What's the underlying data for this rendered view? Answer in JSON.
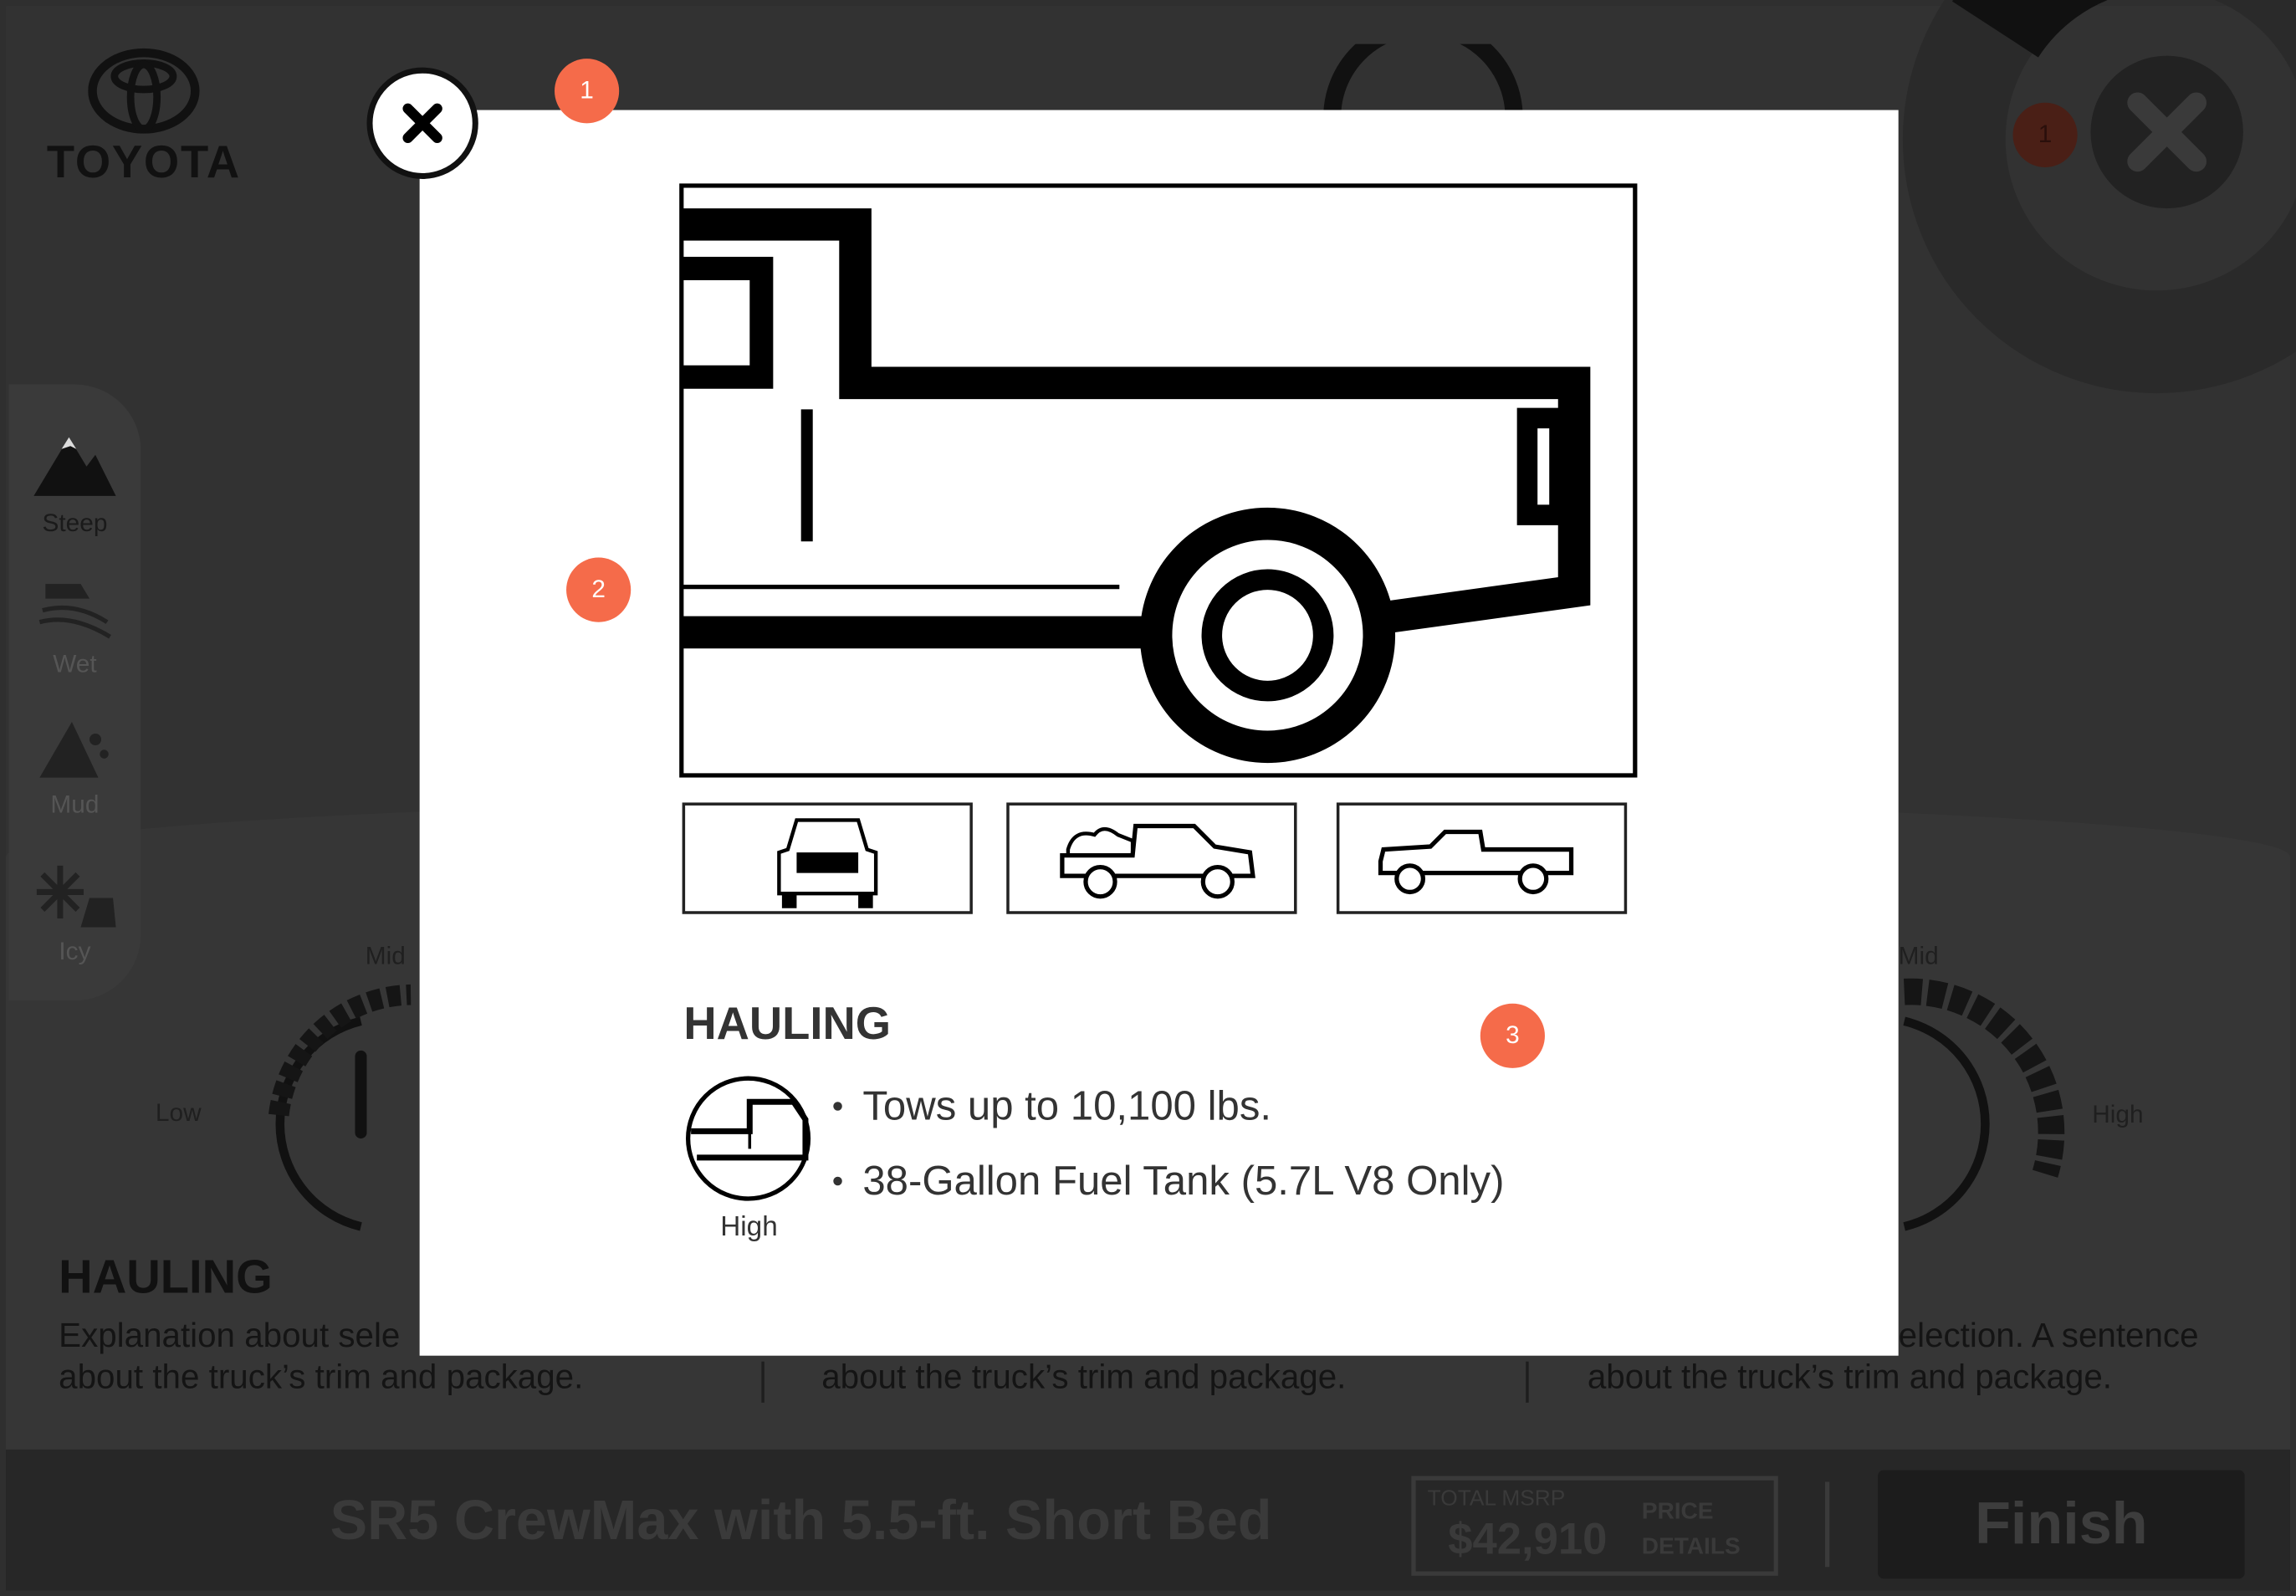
{
  "app": {
    "brand": "TOYOTA"
  },
  "sidebar": {
    "items": [
      {
        "label": "Steep",
        "icon": "mountain-icon",
        "active": true
      },
      {
        "label": "Wet",
        "icon": "wet-road-icon",
        "active": false
      },
      {
        "label": "Mud",
        "icon": "mud-icon",
        "active": false
      },
      {
        "label": "Icy",
        "icon": "snowflake-icon",
        "active": false
      }
    ]
  },
  "dials": {
    "left": {
      "low": "Low",
      "mid": "Mid"
    },
    "right": {
      "mid": "Mid",
      "high": "High"
    }
  },
  "background_section": {
    "heading": "HAULING",
    "col1": {
      "line1": "Explanation about sele",
      "line2": "about the truck’s trim and package."
    },
    "col2": {
      "line2": "about the truck’s trim and package."
    },
    "col3": {
      "line1": "election.  A sentence",
      "line2": "about the truck’s trim and package."
    }
  },
  "bottom_bar": {
    "trim": "SR5 CrewMax with 5.5-ft. Short Bed",
    "msrp_label": "TOTAL MSRP",
    "msrp_value": "$42,910",
    "price_details_line1": "PRICE",
    "price_details_line2": "DETAILS",
    "finish": "Finish"
  },
  "hotspots": {
    "h1": "1",
    "h2": "2",
    "h3": "3",
    "bg_badge": "1"
  },
  "modal": {
    "heading": "HAULING",
    "bullets": [
      "Tows up to 10,100 lbs.",
      "38-Gallon Fuel Tank (5.7L V8 Only)"
    ],
    "badge_label": "High",
    "thumbnails": [
      "truck-front-icon",
      "truck-hauling-icon",
      "truck-side-icon"
    ]
  },
  "colors": {
    "hotspot": "#f56b4a",
    "overlay": "#323232",
    "modal": "#ffffff"
  }
}
